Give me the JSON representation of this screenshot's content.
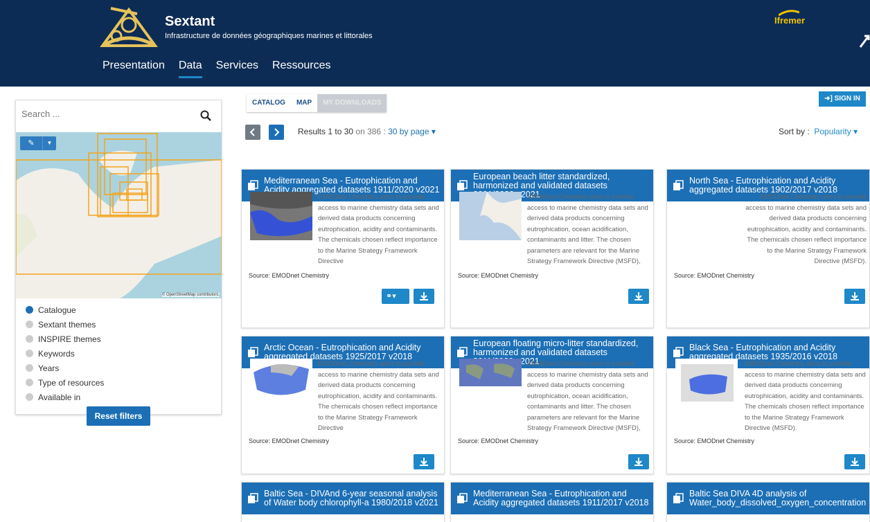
{
  "header": {
    "title": "Sextant",
    "subtitle": "Infrastructure de données géographiques marines et littorales",
    "partner": "Ifremer"
  },
  "nav": [
    "Presentation",
    "Data",
    "Services",
    "Ressources"
  ],
  "tabs": [
    "CATALOG",
    "MAP",
    "MY DOWNLOADS"
  ],
  "signin": "SIGN IN",
  "search": {
    "placeholder": "Search ..."
  },
  "map_credit": "© OpenStreetMap contributors.",
  "filters": [
    "Catalogue",
    "Sextant themes",
    "INSPIRE themes",
    "Keywords",
    "Years",
    "Type of resources",
    "Available in"
  ],
  "reset": "Reset filters",
  "results": {
    "prefix": "Results 1 to 30",
    "on": "on 386 :",
    "per_page": "30 by page"
  },
  "sort": {
    "label": "Sort by :",
    "value": "Popularity"
  },
  "cards": [
    {
      "title": "Mediterranean Sea - Eutrophication and Acidity aggregated datasets 1911/2020 v2021",
      "desc": "EMODnet Chemistry aims to provide access to marine chemistry data sets and derived data products concerning eutrophication, acidity and contaminants. The chemicals chosen reflect importance to the Marine Strategy Framework Directive",
      "source": "Source: EMODnet Chemistry"
    },
    {
      "title": "European beach litter standardized, harmonized and validated datasets 2001/2020 v2021",
      "desc": "EMODnet Chemistry aims to provide access to marine chemistry data sets and derived data products concerning eutrophication, ocean acidification, contaminants and litter. The chosen parameters are relevant for the Marine Strategy Framework Directive (MSFD),",
      "source": "Source: EMODnet Chemistry"
    },
    {
      "title": "North Sea - Eutrophication and Acidity aggregated datasets 1902/2017 v2018",
      "desc": "EMODnet Chemistry aims to provide access to marine chemistry data sets and derived data products concerning eutrophication, acidity and contaminants. The chemicals chosen reflect importance to the Marine Strategy Framework Directive (MSFD).",
      "source": "Source: EMODnet Chemistry"
    },
    {
      "title": "Arctic Ocean - Eutrophication and Acidity aggregated datasets 1925/2017 v2018",
      "desc": "EMODnet Chemistry aims to provide access to marine chemistry data sets and derived data products concerning eutrophication, acidity and contaminants. The chemicals chosen reflect importance to the Marine Strategy Framework Directive",
      "source": "Source: EMODnet Chemistry"
    },
    {
      "title": "European floating micro-litter standardized, harmonized and validated datasets 2011/2020 v2021",
      "desc": "EMODnet Chemistry aims to provide access to marine chemistry data sets and derived data products concerning eutrophication, ocean acidification, contaminants and litter. The chosen parameters are relevant for the Marine Strategy Framework Directive (MSFD),",
      "source": "Source: EMODnet Chemistry"
    },
    {
      "title": "Black Sea - Eutrophication and Acidity aggregated datasets 1935/2016 v2018",
      "desc": "EMODnet Chemistry aims to provide access to marine chemistry data sets and derived data products concerning eutrophication, acidity and contaminants. The chemicals chosen reflect importance to the Marine Strategy Framework Directive (MSFD).",
      "source": "Source: EMODnet Chemistry"
    },
    {
      "title": "Baltic Sea - DIVAnd 6-year seasonal analysis of Water body chlorophyll-a 1980/2018 v2021",
      "desc": "",
      "source": ""
    },
    {
      "title": "Mediterranean Sea - Eutrophication and Acidity aggregated datasets 1911/2017 v2018",
      "desc": "",
      "source": ""
    },
    {
      "title": "Baltic Sea DIVA 4D analysis of Water_body_dissolved_oxygen_concentration",
      "desc": "",
      "source": ""
    }
  ]
}
